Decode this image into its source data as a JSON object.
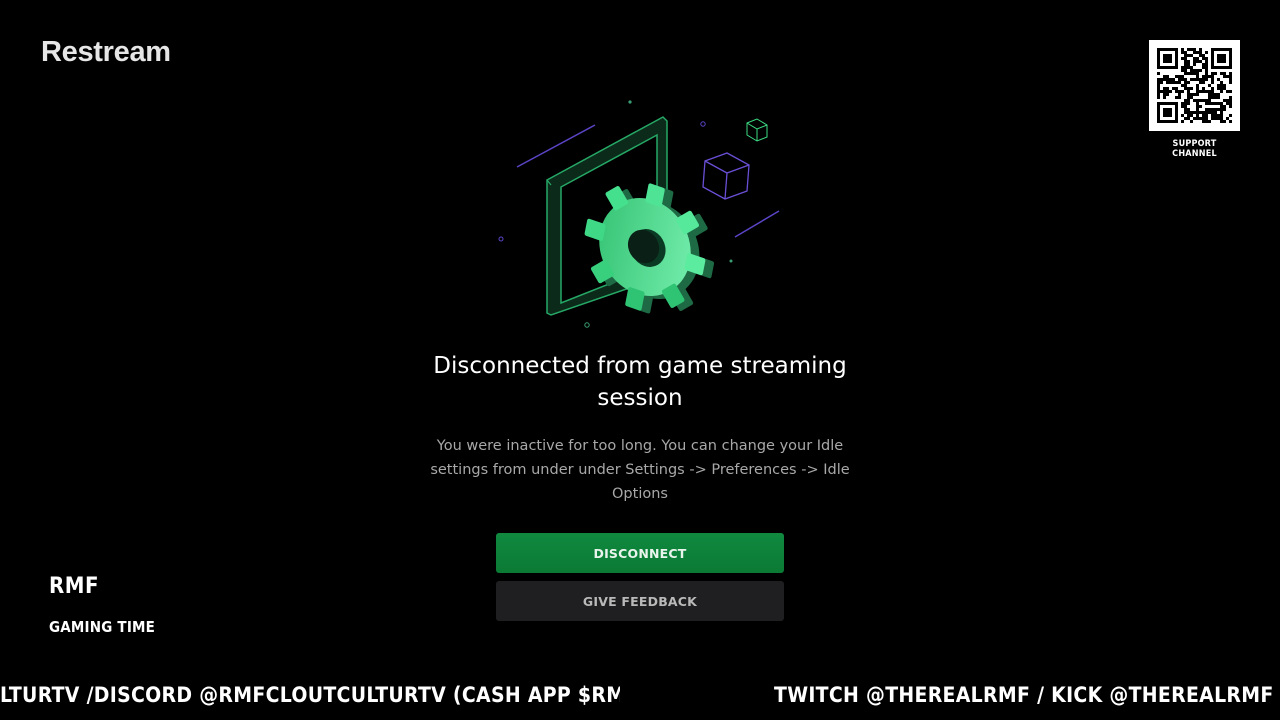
{
  "brand": {
    "logo_text": "Restream"
  },
  "qr": {
    "caption": "SUPPORT CHANNEL",
    "icon": "qr-code-icon"
  },
  "illustration": {
    "icon": "gear-window-illustration",
    "accent_color": "#3ddc84",
    "outline_color": "#6a4fd6"
  },
  "dialog": {
    "title": "Disconnected from game streaming session",
    "message": "You were inactive for too long. You can change your Idle settings from under under Settings -> Preferences -> Idle Options",
    "primary_button": "DISCONNECT",
    "secondary_button": "GIVE FEEDBACK",
    "primary_color": "#10893f",
    "secondary_color": "#1f1f21"
  },
  "overlay": {
    "channel_name": "RMF",
    "subtitle": "GAMING TIME",
    "ticker_left": "LTURTV /DISCORD @RMFCLOUTCULTURTV (CASH APP $RMFSCO)",
    "ticker_right": "TWITCH @THEREALRMF / KICK @THEREALRMF / RUMB"
  }
}
